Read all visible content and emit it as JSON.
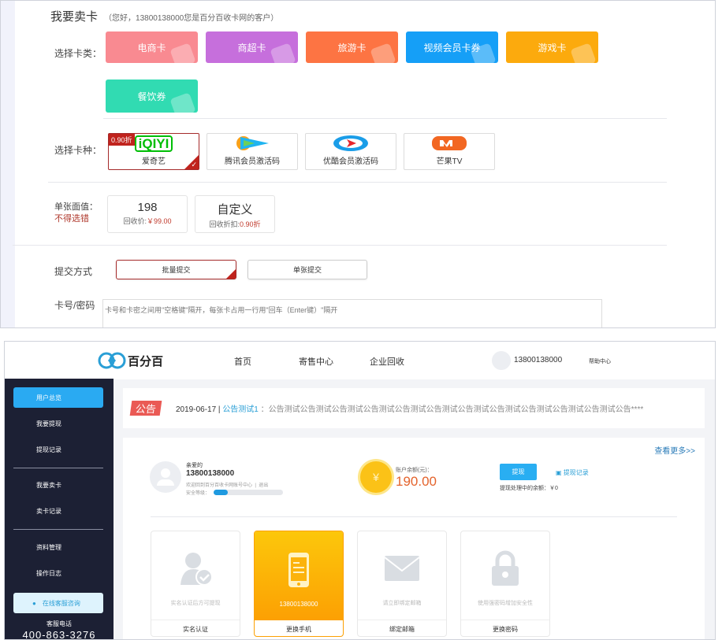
{
  "sell": {
    "title": "我要卖卡",
    "greeting": "（您好，13800138000您是百分百收卡网的客户）",
    "category_label": "选择卡类：",
    "categories": [
      {
        "label": "电商卡",
        "color": "#f98a91"
      },
      {
        "label": "商超卡",
        "color": "#c66fdc"
      },
      {
        "label": "旅游卡",
        "color": "#fd7443"
      },
      {
        "label": "视频会员卡券",
        "color": "#159ff7"
      },
      {
        "label": "游戏卡",
        "color": "#fcaa0d"
      },
      {
        "label": "餐饮券",
        "color": "#31dbb2"
      }
    ],
    "kind_label": "选择卡种：",
    "kinds": [
      {
        "label": "爱奇艺",
        "logo": "iQIYI",
        "discount": "0.90折",
        "selected": true
      },
      {
        "label": "腾讯会员激活码",
        "logo": "tencent-video"
      },
      {
        "label": "优酷会员激活码",
        "logo": "youku"
      },
      {
        "label": "芒果TV",
        "logo": "mango-tv"
      }
    ],
    "face_label": "单张面值：",
    "face_warning": "不得选错",
    "faces": [
      {
        "value": "198",
        "note_prefix": "回收价:",
        "note_value": "￥99.00"
      },
      {
        "value": "自定义",
        "note_prefix": "回收折扣:",
        "note_value": "0.90折"
      }
    ],
    "submit_label": "提交方式",
    "submit_modes": [
      "批量提交",
      "单张提交"
    ],
    "card_label": "卡号/密码",
    "card_placeholder": "卡号和卡密之间用\"空格键\"隔开，每张卡占用一行用\"回车（Enter键）\"隔开"
  },
  "header": {
    "brand": "百分百",
    "nav": [
      "首页",
      "寄售中心",
      "企业回收"
    ],
    "user": "13800138000",
    "help": "帮助中心"
  },
  "sidebar": {
    "items": [
      "用户总览",
      "我要提现",
      "提现记录",
      "我要卖卡",
      "卖卡记录",
      "资料管理",
      "操作日志"
    ],
    "service_button": "在线客服咨询",
    "phone_label": "客服电话",
    "phone": "400-863-3276"
  },
  "notice": {
    "badge": "公告",
    "date": "2019-06-17 |",
    "title": "公告测试1",
    "text": "：公告测试公告测试公告测试公告测试公告测试公告测试公告测试公告测试公告测试公告测试公告测试公告****"
  },
  "account": {
    "more": "查看更多>>",
    "greeting": "亲爱的",
    "phone": "13800138000",
    "welcome": "欢迎回到百分百收卡网账号中心",
    "logout": "退出",
    "security_label": "安全等级：",
    "security_level": 0.2,
    "balance_label": "账户余额(元)：",
    "balance": "190.00",
    "withdraw": "提现",
    "withdraw_record": "提现记录",
    "pending": "提现处理中的余额：￥0"
  },
  "security_cards": [
    {
      "desc": "实名认证后方可提现",
      "action": "实名认证",
      "icon": "user-check-icon"
    },
    {
      "desc": "13800138000",
      "action": "更换手机",
      "icon": "phone-icon",
      "highlight": true
    },
    {
      "desc": "请立即绑定邮箱",
      "action": "绑定邮箱",
      "icon": "mail-icon"
    },
    {
      "desc": "使用强密码增加安全性",
      "action": "更换密码",
      "icon": "lock-icon"
    }
  ]
}
